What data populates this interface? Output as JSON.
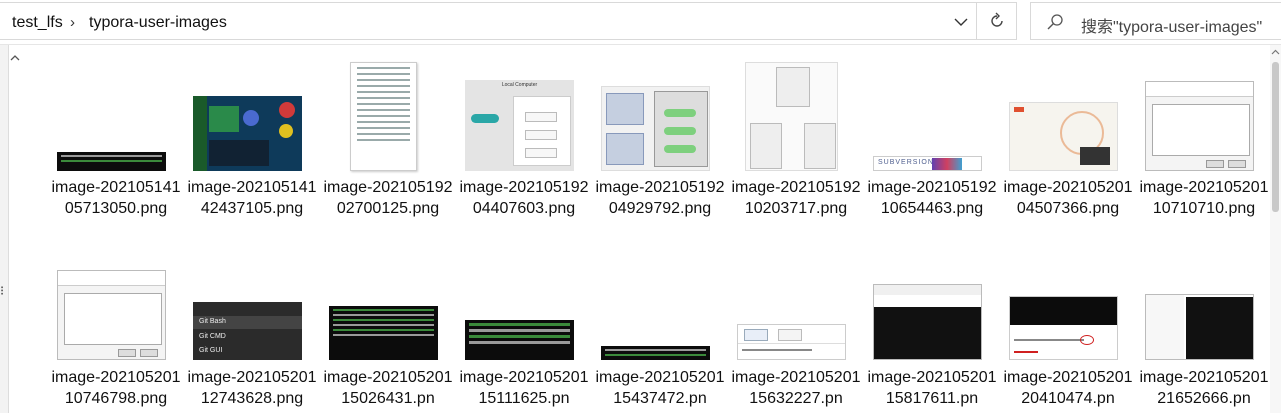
{
  "breadcrumb": {
    "items": [
      "test_lfs",
      "typora-user-images"
    ],
    "separator": "›"
  },
  "search": {
    "placeholder": "搜索\"typora-user-images\""
  },
  "files": [
    {
      "name": "image-20210514105713050.png",
      "kind": "terminal"
    },
    {
      "name": "image-20210514142437105.png",
      "kind": "diagram-dark"
    },
    {
      "name": "image-20210519202700125.png",
      "kind": "document-list"
    },
    {
      "name": "image-20210519204407603.png",
      "kind": "diagram-local"
    },
    {
      "name": "image-20210519204929792.png",
      "kind": "diagram-central"
    },
    {
      "name": "image-20210519210203717.png",
      "kind": "diagram-distributed"
    },
    {
      "name": "image-20210519210654463.png",
      "kind": "banner"
    },
    {
      "name": "image-20210520104507366.png",
      "kind": "website"
    },
    {
      "name": "image-20210520110710710.png",
      "kind": "dialog"
    },
    {
      "name": "image-20210520110746798.png",
      "kind": "dialog"
    },
    {
      "name": "image-20210520112743628.png",
      "kind": "context-menu"
    },
    {
      "name": "image-20210520115026431.pn",
      "kind": "terminal"
    },
    {
      "name": "image-20210520115111625.pn",
      "kind": "terminal-large"
    },
    {
      "name": "image-20210520115437472.pn",
      "kind": "terminal-thin"
    },
    {
      "name": "image-20210520115632227.pn",
      "kind": "explorer"
    },
    {
      "name": "image-20210520115817611.pn",
      "kind": "terminal-window"
    },
    {
      "name": "image-20210520120410474.pn",
      "kind": "terminal-window"
    },
    {
      "name": "image-20210520121652666.pn",
      "kind": "terminal-window"
    }
  ],
  "context_menu": [
    "Git Bash",
    "Git CMD",
    "Git GUI"
  ],
  "diagram_labels": {
    "local_title": "Local Computer",
    "checkout": "Checkout",
    "version_db": "Version Database",
    "file": "File",
    "v3": "Version 3",
    "v2": "Version 2",
    "v1": "Version 1",
    "computer_a": "Computer A",
    "computer_b": "Computer B",
    "central": "Central VCS Server"
  },
  "banner_text": "SUBVERSION"
}
